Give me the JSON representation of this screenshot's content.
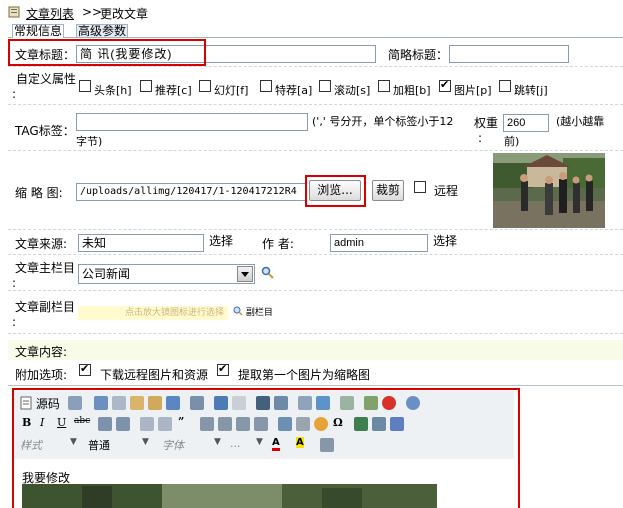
{
  "breadcrumb": {
    "link": "文章列表",
    "separator": ">>",
    "current": "更改文章"
  },
  "tabs": [
    {
      "label": "常规信息"
    },
    {
      "label": "高级参数"
    }
  ],
  "form": {
    "title_label": "文章标题：",
    "title_value": "简   讯(我要修改)",
    "short_title_label": "简略标题：",
    "short_title_value": "",
    "attrs_label": "自定义属性",
    "attrs_colon": ":",
    "attrs": [
      {
        "label": "头条[h]",
        "checked": false
      },
      {
        "label": "推荐[c]",
        "checked": false
      },
      {
        "label": "幻灯[f]",
        "checked": false
      },
      {
        "label": "特荐[a]",
        "checked": false
      },
      {
        "label": "滚动[s]",
        "checked": false
      },
      {
        "label": "加粗[b]",
        "checked": false
      },
      {
        "label": "图片[p]",
        "checked": true
      },
      {
        "label": "跳转[j]",
        "checked": false
      }
    ],
    "tag_label": "TAG标签：",
    "tag_value": "",
    "tag_hint_line1": "(',' 号分开，单个标签小于12",
    "tag_hint_line2": "字节)",
    "weight_label": "权重",
    "weight_colon": ":",
    "weight_value": "260",
    "weight_hint_line1": "(越小越靠",
    "weight_hint_line2": "前)",
    "thumb_label": "缩 略 图:",
    "thumb_value": "/uploads/allimg/120417/1-120417212R4",
    "browse_label": "浏览...",
    "crop_label": "裁剪",
    "remote_label": "远程",
    "source_label": "文章来源:",
    "source_value": "未知",
    "select_label": "选择",
    "author_label": "作  者:",
    "author_value": "admin",
    "author_select_label": "选择",
    "main_col_label": "文章主栏目",
    "main_col_colon": ":",
    "main_col_value": "公司新闻",
    "sub_col_label": "文章副栏目",
    "sub_col_colon": ":",
    "sub_col_hint": "点击放大镜图标进行选择",
    "sub_col_button": "副栏目",
    "content_label": "文章内容:",
    "extra_label": "附加选项:",
    "extra_download": "下载远程图片和资源",
    "extra_first_pic": "提取第一个图片为缩略图"
  },
  "editor": {
    "source_label": "源码",
    "style_label": "样式",
    "format_label": "普通",
    "font_label": "字体",
    "size_label": "...",
    "body_text": "我要修改"
  },
  "colors": {
    "highlight": "#d90000",
    "link": "#000000",
    "tab_active": "#ffffff",
    "tab_inactive": "#e6edf2"
  }
}
